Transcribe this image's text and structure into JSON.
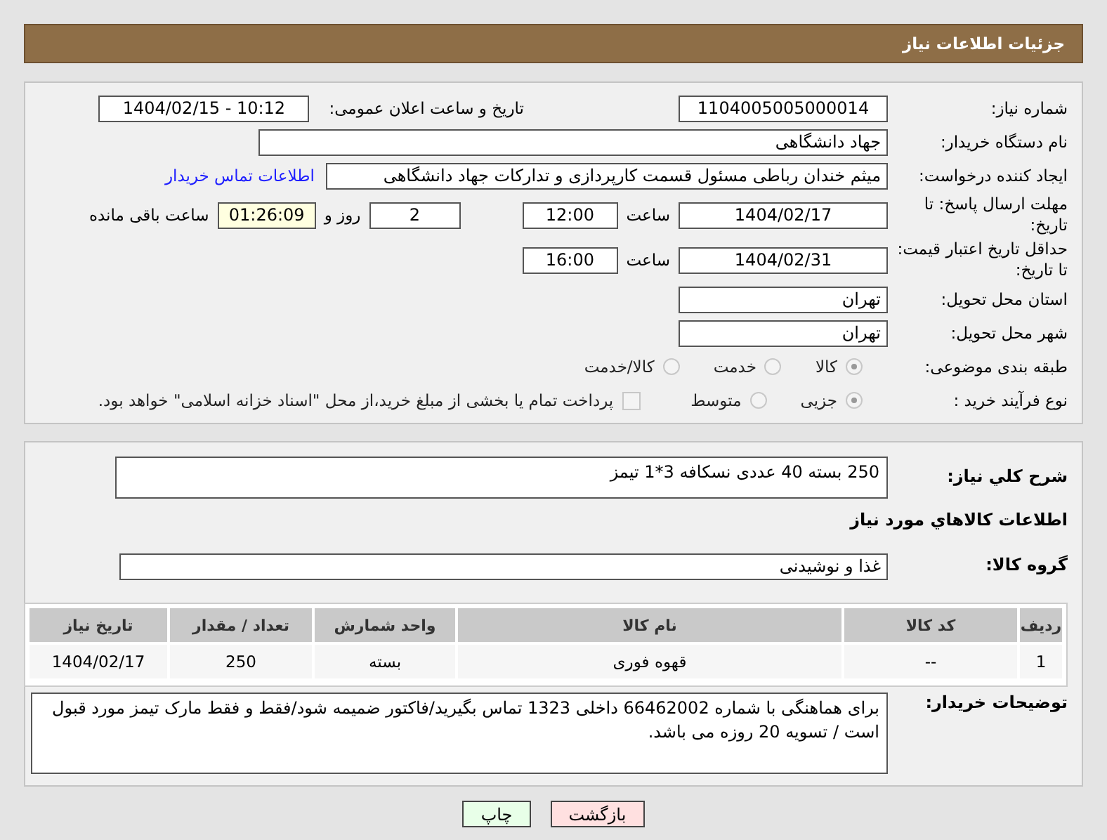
{
  "header": {
    "title": "جزئیات اطلاعات نیاز"
  },
  "need_number": {
    "label": "شماره نیاز:",
    "value": "1104005005000014"
  },
  "announce": {
    "label": "تاریخ و ساعت اعلان عمومی:",
    "value": "1404/02/15 - 10:12"
  },
  "buyer_org": {
    "label": "نام دستگاه خریدار:",
    "value": "جهاد دانشگاهی"
  },
  "requester": {
    "label": "ایجاد کننده درخواست:",
    "value": "میثم خندان رباطی مسئول قسمت کارپردازی و تدارکات جهاد دانشگاهی",
    "contact_link": "اطلاعات تماس خریدار"
  },
  "deadline": {
    "label": "مهلت ارسال پاسخ: تا تاریخ:",
    "date": "1404/02/17",
    "time_label": "ساعت",
    "time": "12:00",
    "days": "2",
    "days_label": "روز و",
    "remaining": "01:26:09",
    "remaining_label": "ساعت باقی مانده"
  },
  "validity": {
    "label": "حداقل تاریخ اعتبار قیمت: تا تاریخ:",
    "date": "1404/02/31",
    "time_label": "ساعت",
    "time": "16:00"
  },
  "province": {
    "label": "استان محل تحویل:",
    "value": "تهران"
  },
  "city": {
    "label": "شهر محل تحویل:",
    "value": "تهران"
  },
  "category": {
    "label": "طبقه بندی موضوعی:",
    "options": [
      {
        "label": "کالا",
        "selected": true
      },
      {
        "label": "خدمت",
        "selected": false
      },
      {
        "label": "کالا/خدمت",
        "selected": false
      }
    ]
  },
  "process": {
    "label": "نوع فرآیند خرید :",
    "options": [
      {
        "label": "جزیی",
        "selected": true
      },
      {
        "label": "متوسط",
        "selected": false
      }
    ],
    "payment": {
      "checked": false,
      "text": "پرداخت تمام یا بخشی از مبلغ خرید،از محل \"اسناد خزانه اسلامی\" خواهد بود."
    }
  },
  "description": {
    "label": "شرح کلي نياز:",
    "value": "250 بسته 40 عددی نسکافه 3*1 تیمز"
  },
  "goods_heading": "اطلاعات کالاهاي مورد نياز",
  "goods_group": {
    "label": "گروه کالا:",
    "value": "غذا و نوشیدنی"
  },
  "table": {
    "columns": [
      "رديف",
      "کد کالا",
      "نام کالا",
      "واحد شمارش",
      "تعداد / مقدار",
      "تاریخ نیاز"
    ],
    "rows": [
      [
        "1",
        "--",
        "قهوه فوری",
        "بسته",
        "250",
        "1404/02/17"
      ]
    ]
  },
  "buyer_notes": {
    "label": "توضیحات خریدار:",
    "value": "برای هماهنگی با شماره 66462002 داخلی 1323 تماس بگیرید/فاکتور ضمیمه شود/فقط و فقط مارک تیمز مورد قبول است / تسویه 20 روزه می باشد."
  },
  "buttons": [
    {
      "label": "بازگشت",
      "kind": "back"
    },
    {
      "label": "چاپ",
      "kind": "print"
    }
  ]
}
